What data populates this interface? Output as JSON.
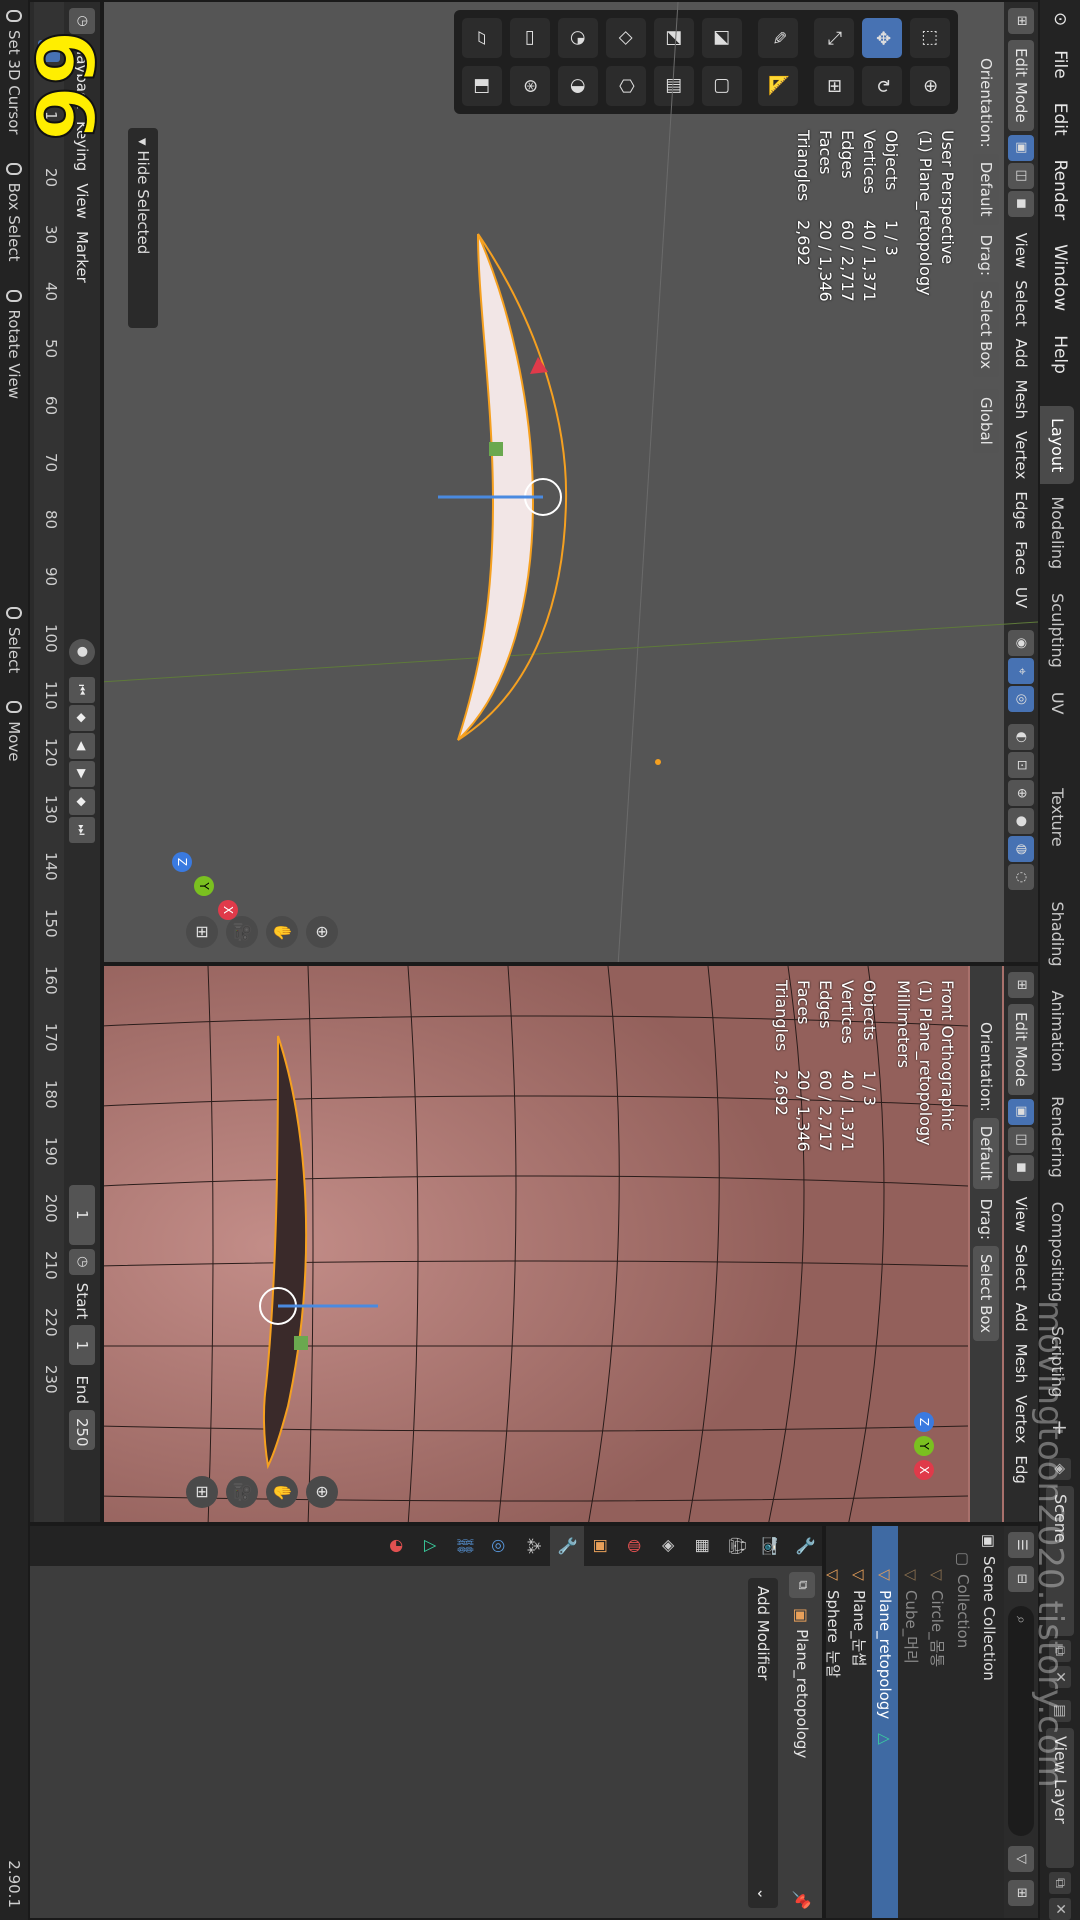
{
  "topbar": {
    "menus": [
      "File",
      "Edit",
      "Render",
      "Window",
      "Help"
    ],
    "workspaces": [
      "Layout",
      "Modeling",
      "Sculpting",
      "UV Editing",
      "Texture Paint",
      "Shading",
      "Animation",
      "Rendering",
      "Compositing",
      "Scripting"
    ],
    "active_workspace": "Layout",
    "add_tab": "+",
    "scene": "Scene",
    "view_layer": "View Layer"
  },
  "watermark": "movingtoon2020.tistory.com",
  "frame_badge": "66",
  "viewport_left": {
    "header": {
      "mode": "Edit Mode",
      "menus": [
        "View",
        "Select",
        "Add",
        "Mesh",
        "Vertex",
        "Edge",
        "Face",
        "UV"
      ]
    },
    "toolsettings": {
      "orientation_label": "Orientation:",
      "orientation_value": "Default",
      "drag_label": "Drag:",
      "drag_value": "Select Box",
      "transform": "Global"
    },
    "overlay": {
      "title": "User Perspective",
      "object": "(1) Plane_retopology",
      "stats": [
        {
          "label": "Objects",
          "value": "1 / 3"
        },
        {
          "label": "Vertices",
          "value": "40 / 1,371"
        },
        {
          "label": "Edges",
          "value": "60 / 2,717"
        },
        {
          "label": "Faces",
          "value": "20 / 1,346"
        },
        {
          "label": "Triangles",
          "value": "2,692"
        }
      ]
    },
    "gizmo": {
      "x": "X",
      "y": "Y",
      "z": "Z"
    },
    "hide_popup": "Hide Selected"
  },
  "viewport_right": {
    "header": {
      "mode": "Edit Mode",
      "menus": [
        "View",
        "Select",
        "Add",
        "Mesh",
        "Vertex",
        "Edg"
      ]
    },
    "toolsettings": {
      "orientation_label": "Orientation:",
      "orientation_value": "Default",
      "drag_label": "Drag:",
      "drag_value": "Select Box"
    },
    "overlay": {
      "title": "Front Orthographic",
      "object": "(1) Plane_retopology",
      "units": "Millimeters",
      "stats": [
        {
          "label": "Objects",
          "value": "1 / 3"
        },
        {
          "label": "Vertices",
          "value": "40 / 1,371"
        },
        {
          "label": "Edges",
          "value": "60 / 2,717"
        },
        {
          "label": "Faces",
          "value": "20 / 1,346"
        },
        {
          "label": "Triangles",
          "value": "2,692"
        }
      ]
    },
    "gizmo": {
      "x": "X",
      "y": "Y",
      "z": "Z"
    }
  },
  "outliner": {
    "root": "Scene Collection",
    "items": [
      {
        "name": "Collection",
        "state": "dim"
      },
      {
        "name": "Circle_몸통",
        "state": "dim"
      },
      {
        "name": "Cube_머리",
        "state": "dim"
      },
      {
        "name": "Plane_retopology",
        "state": "sel"
      },
      {
        "name": "Plane_눈썹",
        "state": ""
      },
      {
        "name": "Sphere_눈알",
        "state": ""
      }
    ]
  },
  "properties": {
    "object": "Plane_retopology",
    "add_modifier": "Add Modifier"
  },
  "timeline": {
    "menus": [
      "Playback",
      "Keying",
      "View",
      "Marker"
    ],
    "current_frame": "1",
    "ticks": [
      "1",
      "10",
      "20",
      "30",
      "40",
      "50",
      "60",
      "70",
      "80",
      "90",
      "100",
      "110",
      "120",
      "130",
      "140",
      "150",
      "160",
      "170",
      "180",
      "190",
      "200",
      "210",
      "220",
      "230"
    ],
    "frame_field": "1",
    "start_label": "Start",
    "start": "1",
    "end_label": "End",
    "end": "250"
  },
  "statusbar": {
    "items": [
      "Set 3D Cursor",
      "Box Select",
      "Rotate View",
      "Select",
      "Move"
    ],
    "version": "2.90.1"
  },
  "colors": {
    "accent": "#4772b3",
    "selection_orange": "#f5a020",
    "mesh_skin": "#a9716c",
    "badge_yellow": "#ffee00"
  }
}
